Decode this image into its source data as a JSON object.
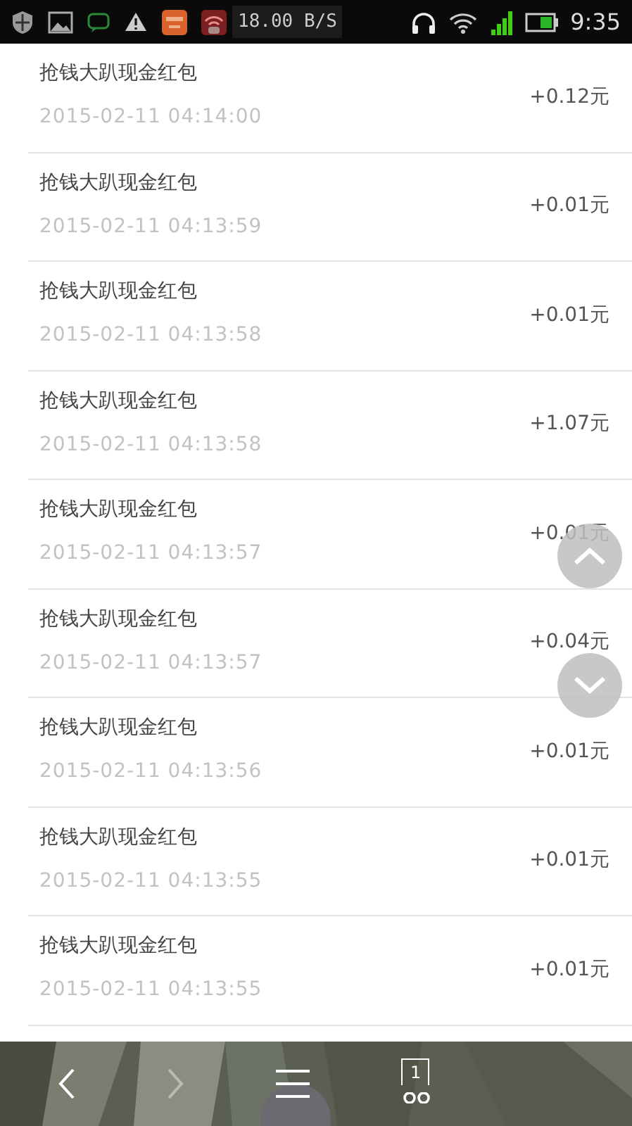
{
  "status_bar": {
    "network_speed": "18.00 B/S",
    "time": "9:35"
  },
  "records": [
    {
      "title": "抢钱大趴现金红包",
      "time": "2015-02-11 04:14:00",
      "amount": "+0.12元"
    },
    {
      "title": "抢钱大趴现金红包",
      "time": "2015-02-11 04:13:59",
      "amount": "+0.01元"
    },
    {
      "title": "抢钱大趴现金红包",
      "time": "2015-02-11 04:13:58",
      "amount": "+0.01元"
    },
    {
      "title": "抢钱大趴现金红包",
      "time": "2015-02-11 04:13:58",
      "amount": "+1.07元"
    },
    {
      "title": "抢钱大趴现金红包",
      "time": "2015-02-11 04:13:57",
      "amount": "+0.01元"
    },
    {
      "title": "抢钱大趴现金红包",
      "time": "2015-02-11 04:13:57",
      "amount": "+0.04元"
    },
    {
      "title": "抢钱大趴现金红包",
      "time": "2015-02-11 04:13:56",
      "amount": "+0.01元"
    },
    {
      "title": "抢钱大趴现金红包",
      "time": "2015-02-11 04:13:55",
      "amount": "+0.01元"
    },
    {
      "title": "抢钱大趴现金红包",
      "time": "2015-02-11 04:13:55",
      "amount": "+0.01元"
    }
  ],
  "bottom_bar": {
    "back_disabled": false,
    "forward_disabled": true,
    "tab_count": "1"
  }
}
